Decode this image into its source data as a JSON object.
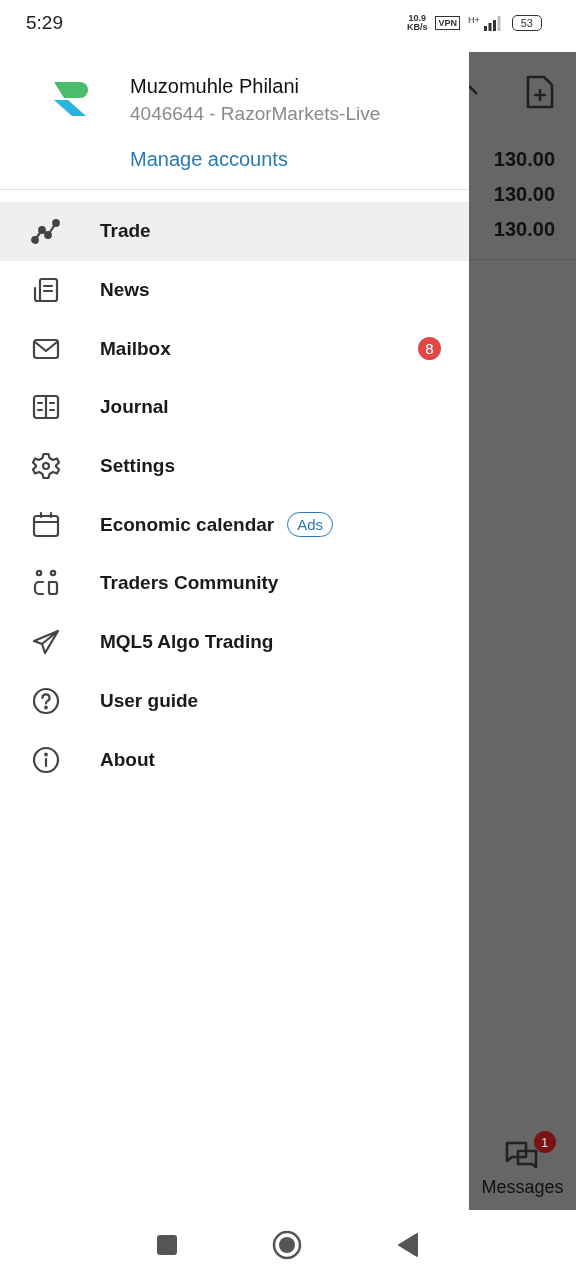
{
  "status_bar": {
    "time": "5:29",
    "speed": "10.9",
    "speed_unit": "KB/s",
    "vpn": "VPN",
    "network": "H+",
    "battery": "53"
  },
  "drawer": {
    "account": {
      "name": "Muzomuhle Philani",
      "server": "4046644 - RazorMarkets-Live",
      "manage": "Manage accounts"
    },
    "items": [
      {
        "label": "Trade",
        "selected": true
      },
      {
        "label": "News",
        "selected": false
      },
      {
        "label": "Mailbox",
        "selected": false,
        "badge": "8"
      },
      {
        "label": "Journal",
        "selected": false
      },
      {
        "label": "Settings",
        "selected": false
      },
      {
        "label": "Economic calendar",
        "selected": false,
        "tag": "Ads"
      },
      {
        "label": "Traders Community",
        "selected": false
      },
      {
        "label": "MQL5 Algo Trading",
        "selected": false
      },
      {
        "label": "User guide",
        "selected": false
      },
      {
        "label": "About",
        "selected": false
      }
    ]
  },
  "background": {
    "prices": [
      "130.00",
      "130.00",
      "130.00"
    ],
    "messages": {
      "label": "Messages",
      "badge": "1"
    }
  }
}
